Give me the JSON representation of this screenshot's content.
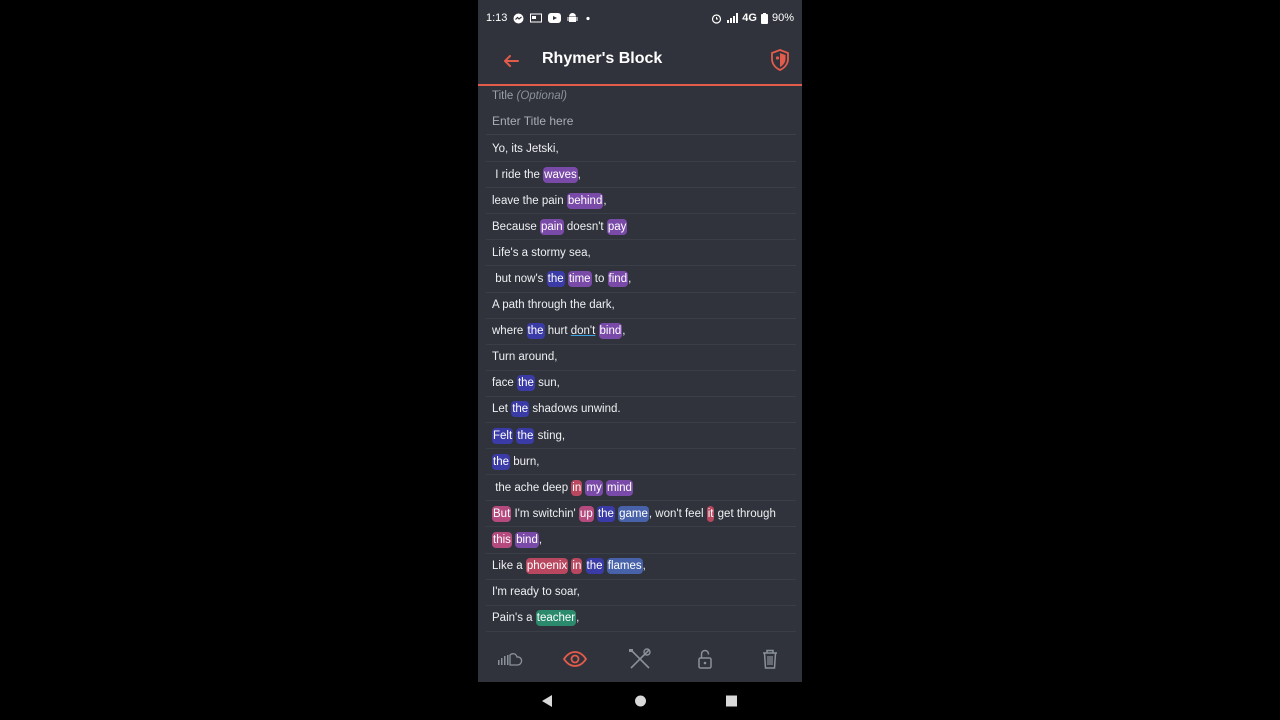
{
  "status": {
    "time": "1:13",
    "network": "4G",
    "battery": "90%",
    "left_icons": [
      "messenger-icon",
      "news-icon",
      "youtube-icon",
      "android-icon",
      "dot-icon"
    ],
    "right_icons": [
      "alarm-icon",
      "signal-icon",
      "battery-icon"
    ]
  },
  "appbar": {
    "title": "Rhymer's Block",
    "back_icon": "back-arrow-icon",
    "shield_icon": "shield-icon"
  },
  "editor": {
    "title_label": "Title",
    "title_optional": "(Optional)",
    "title_placeholder": "Enter Title here",
    "lines": [
      [
        {
          "t": "Yo, its Jetski,"
        }
      ],
      [
        {
          "t": " I ride the "
        },
        {
          "t": "waves",
          "c": "purple"
        },
        {
          "t": ","
        }
      ],
      [
        {
          "t": "leave the pain "
        },
        {
          "t": "behind",
          "c": "purple"
        },
        {
          "t": ","
        }
      ],
      [
        {
          "t": "Because "
        },
        {
          "t": "pain",
          "c": "purple"
        },
        {
          "t": " doesn't "
        },
        {
          "t": "pay",
          "c": "purple"
        }
      ],
      [
        {
          "t": "Life's a stormy sea,"
        }
      ],
      [
        {
          "t": " but now's "
        },
        {
          "t": "the",
          "c": "blue"
        },
        {
          "t": " "
        },
        {
          "t": "time",
          "c": "purple"
        },
        {
          "t": " to "
        },
        {
          "t": "find",
          "c": "purple"
        },
        {
          "t": ","
        }
      ],
      [
        {
          "t": "A path through the dark,"
        }
      ],
      [
        {
          "t": "where "
        },
        {
          "t": "the",
          "c": "blue"
        },
        {
          "t": " hurt "
        },
        {
          "t": "don't",
          "c": "underline"
        },
        {
          "t": " "
        },
        {
          "t": "bind",
          "c": "purple"
        },
        {
          "t": ","
        }
      ],
      [
        {
          "t": "Turn around,"
        }
      ],
      [
        {
          "t": "face "
        },
        {
          "t": "the",
          "c": "blue"
        },
        {
          "t": " sun,"
        }
      ],
      [
        {
          "t": "Let "
        },
        {
          "t": "the",
          "c": "blue"
        },
        {
          "t": " shadows unwind."
        }
      ],
      [
        {
          "t": "Felt",
          "c": "blue"
        },
        {
          "t": " "
        },
        {
          "t": "the",
          "c": "blue"
        },
        {
          "t": " sting,"
        }
      ],
      [
        {
          "t": "the",
          "c": "blue"
        },
        {
          "t": " burn,"
        }
      ],
      [
        {
          "t": " the ache deep "
        },
        {
          "t": "in",
          "c": "red"
        },
        {
          "t": " "
        },
        {
          "t": "my",
          "c": "purple"
        },
        {
          "t": " "
        },
        {
          "t": "mind",
          "c": "purple"
        }
      ],
      [
        {
          "t": "But",
          "c": "pink"
        },
        {
          "t": " I'm switchin' "
        },
        {
          "t": "up",
          "c": "pink"
        },
        {
          "t": " "
        },
        {
          "t": "the",
          "c": "blue"
        },
        {
          "t": " "
        },
        {
          "t": "game",
          "c": "steel"
        },
        {
          "t": ", won't feel "
        },
        {
          "t": "it",
          "c": "red"
        },
        {
          "t": " get through"
        }
      ],
      [
        {
          "t": "this",
          "c": "pink"
        },
        {
          "t": " "
        },
        {
          "t": "bind",
          "c": "purple"
        },
        {
          "t": ","
        }
      ],
      [
        {
          "t": "Like a "
        },
        {
          "t": "phoenix",
          "c": "red"
        },
        {
          "t": " "
        },
        {
          "t": "in",
          "c": "red"
        },
        {
          "t": " "
        },
        {
          "t": "the",
          "c": "blue"
        },
        {
          "t": " "
        },
        {
          "t": "flames",
          "c": "steel"
        },
        {
          "t": ","
        }
      ],
      [
        {
          "t": "I'm ready to soar,"
        }
      ],
      [
        {
          "t": "Pain's a "
        },
        {
          "t": "teacher",
          "c": "green"
        },
        {
          "t": ","
        }
      ]
    ]
  },
  "bottom_bar": {
    "items": [
      "soundcloud-icon",
      "eye-icon",
      "tools-icon",
      "lock-icon",
      "trash-icon"
    ],
    "active": "eye-icon"
  },
  "nav_bar": {
    "items": [
      "back-triangle-icon",
      "home-circle-icon",
      "recents-square-icon"
    ]
  },
  "colors": {
    "accent": "#e35b4b",
    "background": "#30333b",
    "purple": "#7a4aa8",
    "blue": "#3b3ba8",
    "pink": "#b44a7e",
    "red": "#b8475f",
    "steel": "#4762a8",
    "green": "#2b8a6b"
  }
}
